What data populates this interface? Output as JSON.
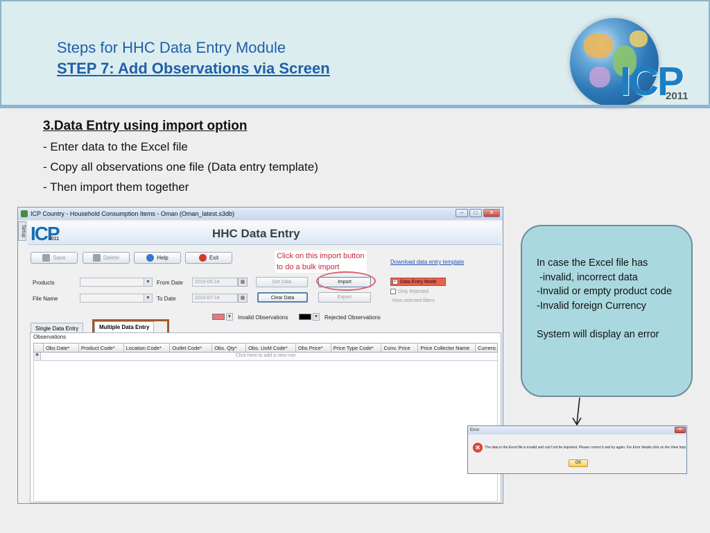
{
  "slide": {
    "title_line1": "Steps for HHC Data Entry Module",
    "title_line2": "STEP 7: Add Observations via  Screen",
    "logo_text": "ICP",
    "logo_year": "2011"
  },
  "content": {
    "heading": "3.Data Entry  using import option",
    "bullets": [
      "- Enter data to the Excel file",
      "- Copy all observations one file (Data entry template)",
      "- Then import them together"
    ]
  },
  "app": {
    "window_title": "ICP Country - Household Consumption Items - Oman (Oman_latest.s3db)",
    "side_tab": "Setup",
    "banner_logo": "ICP",
    "banner_logo_year": "2011",
    "banner_title": "HHC Data Entry",
    "toolbar": {
      "save": "Save",
      "delete": "Delete",
      "help": "Help",
      "exit": "Exit"
    },
    "annotation_line1": "Click on this import button",
    "annotation_line2": "to do a bulk import",
    "download_link": "Download data entry template",
    "filters": {
      "products_label": "Products",
      "file_name_label": "File Name",
      "from_date_label": "From Date",
      "to_date_label": "To Date",
      "from_date_value": "2010-05-14",
      "to_date_value": "2010-07-14"
    },
    "buttons": {
      "get_data": "Get Data",
      "import": "Import",
      "clear_data": "Clear Data",
      "export": "Export"
    },
    "options": {
      "data_entry_mode": "Data Entry Mode",
      "only_rejected": "Only Rejected",
      "view_selected_filters": "View selected filters"
    },
    "legend": {
      "invalid": "Invalid Observations",
      "rejected": "Rejected Observations",
      "invalid_color": "#e87a7a",
      "rejected_color": "#000000"
    },
    "tabs": [
      "Single Data Entry",
      "Multiple Data Entry"
    ],
    "observations_title": "Observations",
    "grid_columns": [
      "Obs Date*",
      "Product Code*",
      "Location Code*",
      "Outlet Code*",
      "Obs. Qty*",
      "Obs. UoM Code*",
      "Obs Price*",
      "Price Type Code*",
      "Conv. Price",
      "Price Collector Name",
      "Currenc"
    ],
    "grid_placeholder": "Click here to add a new row"
  },
  "callout": {
    "text": "In case the Excel file has\n -invalid, incorrect data\n-Invalid or empty product code\n-Invalid foreign Currency\n\nSystem will display an error"
  },
  "error_dialog": {
    "title": "Error",
    "message": "The data in the Excel file is invalid and can't not be imported. Please correct it and try again. For Error details click on the View Import Error Details link.",
    "ok": "OK"
  }
}
